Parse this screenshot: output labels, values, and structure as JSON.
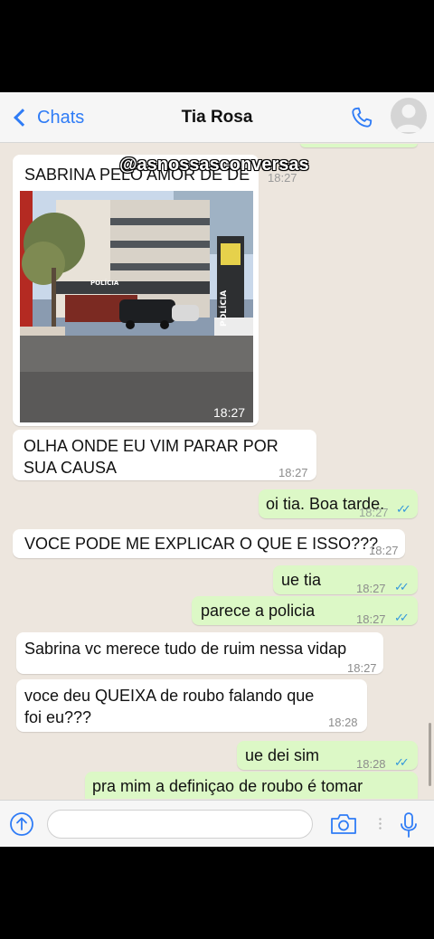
{
  "header": {
    "back_label": "Chats",
    "title": "Tia Rosa"
  },
  "watermark": "@asnossasconversas",
  "messages": [
    {
      "dir": "in",
      "text": "SABRINA PELO AMOR DE DEUS",
      "time": "18:27"
    },
    {
      "dir": "in",
      "type": "image",
      "image_sign": "POLÍCIA",
      "time": "18:27"
    },
    {
      "dir": "in",
      "text": "OLHA ONDE EU VIM PARAR POR SUA CAUSA",
      "time": "18:27"
    },
    {
      "dir": "out",
      "text": "oi tia. Boa tarde.",
      "time": "18:27",
      "status": "read"
    },
    {
      "dir": "in",
      "text": "VOCE PODE ME EXPLICAR O QUE E ISSO???",
      "time": "18:27"
    },
    {
      "dir": "out",
      "text": "ue tia",
      "time": "18:27",
      "status": "read"
    },
    {
      "dir": "out",
      "text": "parece a policia",
      "time": "18:27",
      "status": "read"
    },
    {
      "dir": "in",
      "text": "Sabrina vc merece tudo de ruim nessa vidap",
      "time": "18:27"
    },
    {
      "dir": "in",
      "text": "voce deu QUEIXA de roubo falando que foi eu???",
      "time": "18:28"
    },
    {
      "dir": "out",
      "text": "ue dei sim",
      "time": "18:28",
      "status": "read"
    },
    {
      "dir": "out",
      "text": "pra mim a definiçao de roubo é tomar"
    }
  ],
  "input": {
    "placeholder": ""
  },
  "colors": {
    "accent": "#2f7cf6",
    "outgoing": "#dcf8c6",
    "incoming": "#ffffff",
    "background": "#ede6de",
    "read_ticks": "#3498db"
  },
  "icons": [
    "chevron-left-icon",
    "phone-icon",
    "avatar-icon",
    "upload-icon",
    "camera-icon",
    "mic-icon"
  ]
}
